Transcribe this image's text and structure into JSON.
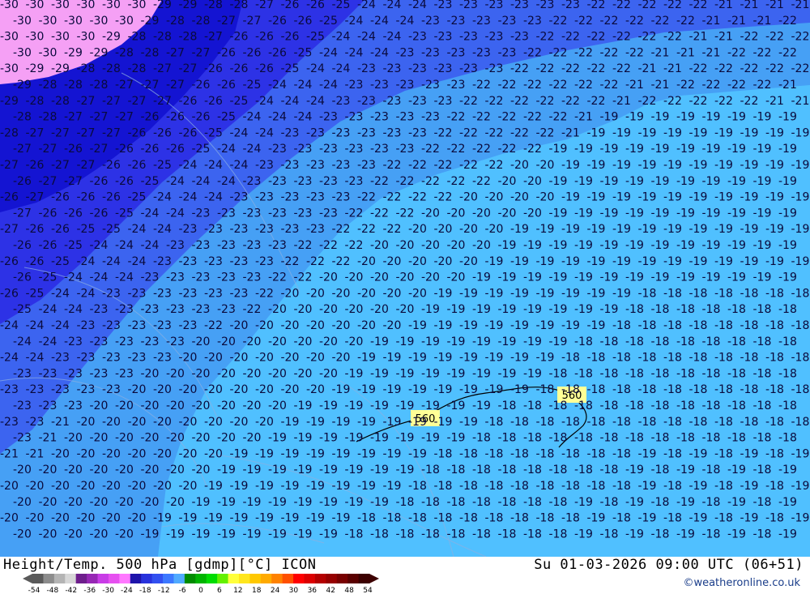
{
  "map": {
    "title": "Height/Temp. 500 hPa [gdmp][°C] ICON",
    "valid_time": "Su 01-03-2026 09:00 UTC (06+51)",
    "credit": "©weatheronline.co.uk",
    "contour_label": "560",
    "legend": {
      "ticks": [
        "-54",
        "-48",
        "-42",
        "-36",
        "-30",
        "-24",
        "-18",
        "-12",
        "-6",
        "0",
        "6",
        "12",
        "18",
        "24",
        "30",
        "36",
        "42",
        "48",
        "54"
      ],
      "colors": [
        "#5a5a5a",
        "#8c8c8c",
        "#b4b4b4",
        "#d7d7d7",
        "#6e1e8c",
        "#9628b4",
        "#c83ce6",
        "#e650f0",
        "#ff78ff",
        "#1e14aa",
        "#2832dc",
        "#3250f0",
        "#3c78ff",
        "#50aaff",
        "#008c00",
        "#00b400",
        "#00dc00",
        "#64f000",
        "#ffff3c",
        "#ffe61e",
        "#ffc800",
        "#ffaa00",
        "#ff8200",
        "#ff5000",
        "#ff0000",
        "#dc0000",
        "#b40000",
        "#960000",
        "#780000",
        "#5a0000",
        "#3c0000"
      ]
    },
    "zones": {
      "purple": "#f5a0f5",
      "deep_blue": "#1414d2",
      "blue": "#2d32e6",
      "mid_blue": "#3c64f0",
      "light_blue": "#46a0f5",
      "sky": "#50c0ff"
    }
  }
}
